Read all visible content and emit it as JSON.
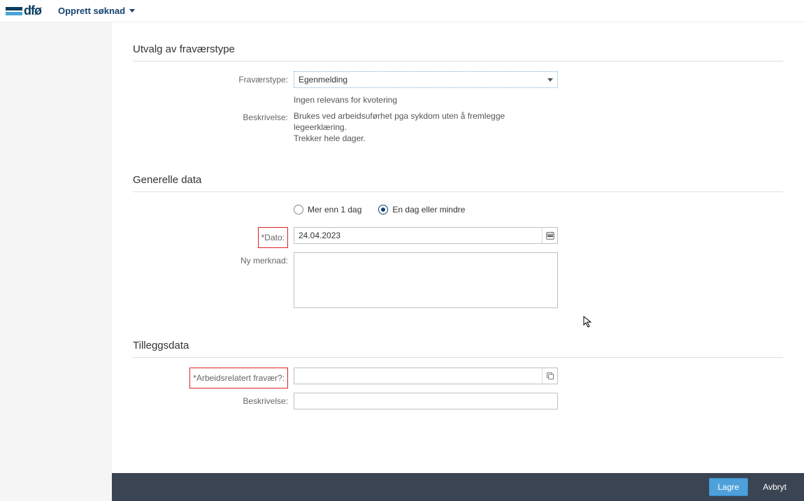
{
  "header": {
    "logo_text": "dfø",
    "page_title": "Opprett søknad"
  },
  "section1": {
    "title": "Utvalg av fraværstype",
    "absence_type_label": "Fraværstype:",
    "absence_type_value": "Egenmelding",
    "quota_hint": "Ingen relevans for kvotering",
    "description_label": "Beskrivelse:",
    "description_line1": "Brukes ved arbeidsuførhet pga sykdom uten å fremlegge legeerklæring.",
    "description_line2": "Trekker hele dager."
  },
  "section2": {
    "title": "Generelle data",
    "radio_more": "Mer enn 1 dag",
    "radio_one": "En dag eller mindre",
    "radio_selected": "one",
    "date_label": "*Dato:",
    "date_value": "24.04.2023",
    "note_label": "Ny merknad:",
    "note_value": ""
  },
  "section3": {
    "title": "Tilleggsdata",
    "work_related_label": "*Arbeidsrelatert fravær?:",
    "work_related_value": "",
    "description_label": "Beskrivelse:",
    "description_value": ""
  },
  "footer": {
    "save": "Lagre",
    "cancel": "Avbryt"
  }
}
